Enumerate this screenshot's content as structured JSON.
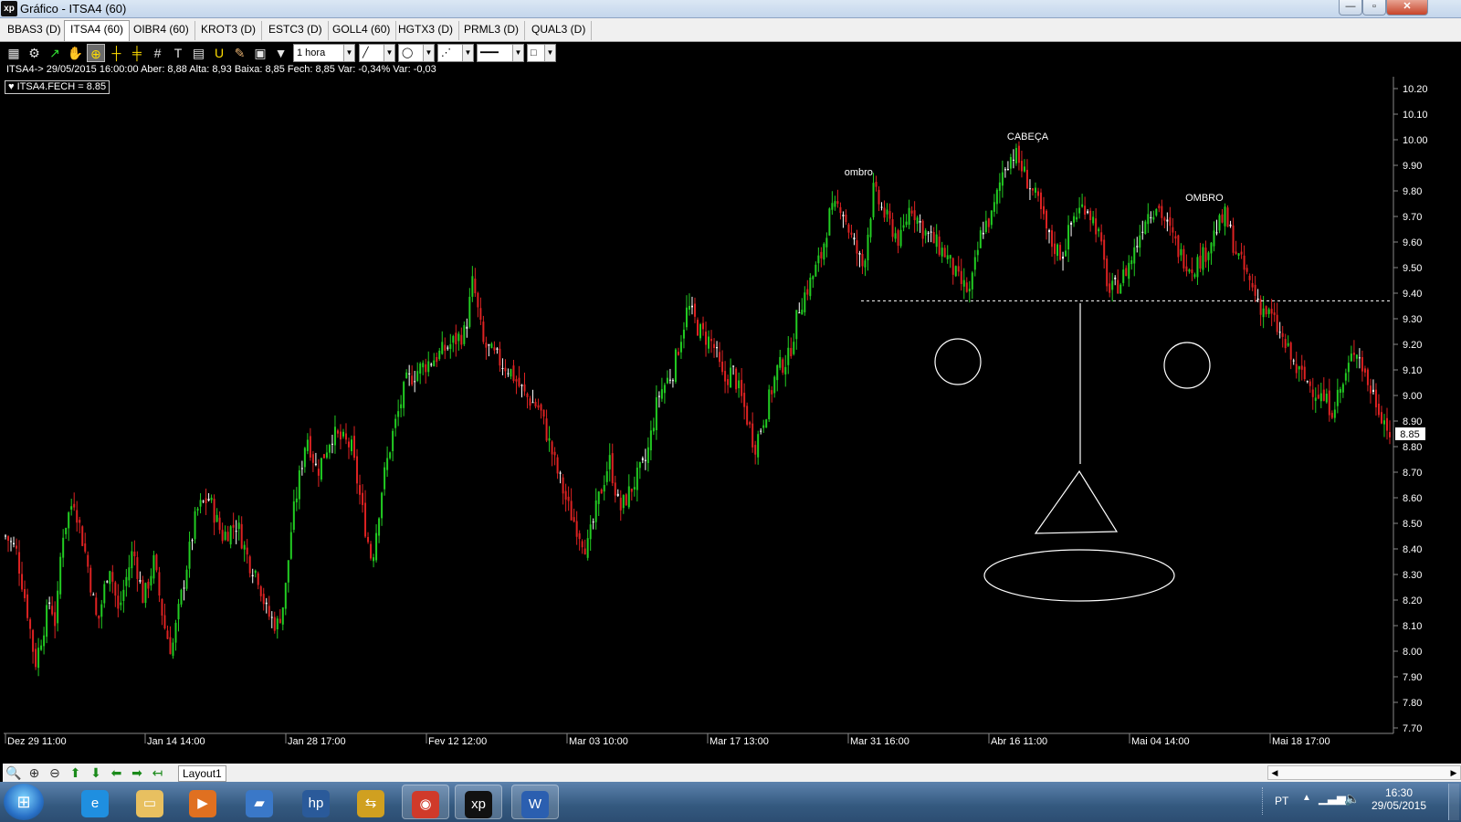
{
  "window": {
    "app_icon": "xp",
    "title": "Gráfico - ITSA4 (60)",
    "minimize": "—",
    "restore": "▫",
    "close": "✕"
  },
  "tabs": [
    {
      "label": "BBAS3 (D)"
    },
    {
      "label": "ITSA4 (60)",
      "active": true
    },
    {
      "label": "OIBR4 (60)"
    },
    {
      "label": "KROT3 (D)"
    },
    {
      "label": "ESTC3 (D)"
    },
    {
      "label": "GOLL4 (60)"
    },
    {
      "label": "HGTX3 (D)"
    },
    {
      "label": "PRML3 (D)"
    },
    {
      "label": "QUAL3 (D)"
    }
  ],
  "toolbar": {
    "icons": [
      "chart-icon",
      "gear-icon",
      "trend-icon",
      "hand-icon",
      "zoom-crosshair-icon",
      "crosshair-icon",
      "multi-crosshair-icon",
      "grid-icon",
      "text-icon",
      "calculator-icon",
      "magnet-icon",
      "brush-icon",
      "clipboard-icon",
      "filter-icon"
    ],
    "period": "1 hora",
    "line_tool": "line-icon",
    "shape_tool": "circle-icon",
    "fan_tool": "fan-icon",
    "line_style": "solid",
    "color_box": "#ffffff"
  },
  "info": {
    "line": "ITSA4-> 29/05/2015 16:00:00 Aber: 8,88 Alta: 8,93 Baixa: 8,85 Fech: 8,85 Var: -0,34% Var: -0,03",
    "legend": "ITSA4.FECH = 8.85"
  },
  "chart": {
    "symbol": "ITSA4",
    "interval": "60",
    "y_ticks": [
      "10.20",
      "10.10",
      "10.00",
      "9.90",
      "9.80",
      "9.70",
      "9.60",
      "9.50",
      "9.40",
      "9.30",
      "9.20",
      "9.10",
      "9.00",
      "8.90",
      "8.80",
      "8.70",
      "8.60",
      "8.50",
      "8.40",
      "8.30",
      "8.20",
      "8.10",
      "8.00",
      "7.90",
      "7.80",
      "7.70"
    ],
    "y_range": [
      7.7,
      10.2
    ],
    "x_ticks": [
      "Dez 29 11:00",
      "Jan 14 14:00",
      "Jan 28 17:00",
      "Fev 12 12:00",
      "Mar 03 10:00",
      "Mar 17 13:00",
      "Mar 31 16:00",
      "Abr 16 11:00",
      "Mai 04 14:00",
      "Mai 18 17:00"
    ],
    "last_price": "8.85",
    "up_color": "#22cc22",
    "down_color": "#dd2222",
    "neutral_color": "#ffffff",
    "price_path": [
      [
        0,
        8.45
      ],
      [
        0.7,
        8.4
      ],
      [
        1.5,
        8.15
      ],
      [
        2.0,
        7.95
      ],
      [
        3.0,
        8.2
      ],
      [
        3.4,
        8.1
      ],
      [
        3.8,
        8.45
      ],
      [
        4.6,
        8.6
      ],
      [
        5.5,
        8.35
      ],
      [
        6.2,
        8.1
      ],
      [
        7.0,
        8.35
      ],
      [
        7.6,
        8.15
      ],
      [
        8.6,
        8.4
      ],
      [
        9.3,
        8.2
      ],
      [
        10.0,
        8.35
      ],
      [
        10.7,
        8.1
      ],
      [
        11.2,
        8.0
      ],
      [
        12.1,
        8.3
      ],
      [
        12.9,
        8.55
      ],
      [
        13.7,
        8.6
      ],
      [
        14.6,
        8.45
      ],
      [
        15.6,
        8.5
      ],
      [
        16.4,
        8.35
      ],
      [
        17.0,
        8.3
      ],
      [
        17.6,
        8.15
      ],
      [
        18.3,
        8.1
      ],
      [
        18.8,
        8.2
      ],
      [
        19.3,
        8.5
      ],
      [
        20.3,
        8.85
      ],
      [
        21.0,
        8.7
      ],
      [
        22.0,
        8.85
      ],
      [
        23.3,
        8.8
      ],
      [
        24.2,
        8.5
      ],
      [
        24.7,
        8.35
      ],
      [
        25.4,
        8.65
      ],
      [
        26.1,
        8.85
      ],
      [
        27.0,
        9.05
      ],
      [
        27.8,
        9.1
      ],
      [
        29.0,
        9.15
      ],
      [
        30.0,
        9.2
      ],
      [
        31.0,
        9.25
      ],
      [
        31.5,
        9.45
      ],
      [
        32.2,
        9.2
      ],
      [
        33.0,
        9.15
      ],
      [
        34.0,
        9.1
      ],
      [
        35.0,
        9.0
      ],
      [
        36.0,
        8.95
      ],
      [
        37.2,
        8.7
      ],
      [
        38.0,
        8.55
      ],
      [
        39.2,
        8.4
      ],
      [
        40.0,
        8.6
      ],
      [
        40.7,
        8.75
      ],
      [
        41.4,
        8.55
      ],
      [
        42.3,
        8.65
      ],
      [
        43.2,
        8.75
      ],
      [
        44.0,
        9.0
      ],
      [
        45.0,
        9.1
      ],
      [
        46.0,
        9.35
      ],
      [
        46.8,
        9.25
      ],
      [
        47.7,
        9.2
      ],
      [
        48.4,
        9.05
      ],
      [
        49.0,
        9.1
      ],
      [
        49.8,
        8.95
      ],
      [
        50.5,
        8.8
      ],
      [
        51.3,
        8.95
      ],
      [
        52.0,
        9.1
      ],
      [
        52.8,
        9.15
      ],
      [
        53.5,
        9.35
      ],
      [
        54.3,
        9.45
      ],
      [
        55.0,
        9.55
      ],
      [
        55.5,
        9.7
      ],
      [
        56.3,
        9.75
      ],
      [
        57.1,
        9.6
      ],
      [
        57.8,
        9.5
      ],
      [
        58.5,
        9.8
      ],
      [
        59.3,
        9.7
      ],
      [
        60.3,
        9.6
      ],
      [
        61.0,
        9.75
      ],
      [
        61.8,
        9.65
      ],
      [
        62.6,
        9.6
      ],
      [
        63.4,
        9.55
      ],
      [
        64.2,
        9.45
      ],
      [
        65.0,
        9.4
      ],
      [
        65.8,
        9.65
      ],
      [
        66.5,
        9.7
      ],
      [
        67.3,
        9.9
      ],
      [
        68.0,
        9.95
      ],
      [
        68.8,
        9.85
      ],
      [
        69.6,
        9.75
      ],
      [
        70.4,
        9.6
      ],
      [
        71.2,
        9.55
      ],
      [
        72.0,
        9.7
      ],
      [
        72.8,
        9.75
      ],
      [
        73.6,
        9.65
      ],
      [
        74.4,
        9.4
      ],
      [
        75.2,
        9.45
      ],
      [
        76.0,
        9.55
      ],
      [
        76.8,
        9.7
      ],
      [
        77.6,
        9.75
      ],
      [
        78.4,
        9.65
      ],
      [
        79.2,
        9.55
      ],
      [
        80.0,
        9.5
      ],
      [
        80.8,
        9.55
      ],
      [
        81.6,
        9.65
      ],
      [
        82.2,
        9.7
      ],
      [
        83.0,
        9.55
      ],
      [
        83.8,
        9.45
      ],
      [
        84.6,
        9.35
      ],
      [
        85.4,
        9.3
      ],
      [
        86.2,
        9.2
      ],
      [
        87.0,
        9.1
      ],
      [
        87.8,
        9.05
      ],
      [
        88.6,
        9.0
      ],
      [
        89.4,
        8.95
      ],
      [
        90.2,
        9.05
      ],
      [
        91.0,
        9.2
      ],
      [
        91.8,
        9.05
      ],
      [
        92.6,
        8.95
      ],
      [
        93.3,
        8.85
      ]
    ],
    "neckline": 9.37,
    "annotations": [
      {
        "text": "ombro",
        "x": 57.5,
        "y": 9.86
      },
      {
        "text": "CABEÇA",
        "x": 68.9,
        "y": 10.0
      },
      {
        "text": "OMBRO",
        "x": 80.8,
        "y": 9.76
      }
    ]
  },
  "nav": {
    "icons": [
      "zoom-icon",
      "zoom-in-icon",
      "zoom-out-icon",
      "arrow-up-icon",
      "arrow-down-icon",
      "arrow-left-icon",
      "arrow-right-icon",
      "arrow-end-icon"
    ],
    "layout_tab": "Layout1"
  },
  "taskbar": {
    "apps": [
      "ie-icon",
      "explorer-icon",
      "media-player-icon",
      "network-icon",
      "hp-icon",
      "transfer-icon",
      "chrome-icon",
      "xp-app-icon",
      "word-icon"
    ],
    "lang": "PT",
    "time": "16:30",
    "date": "29/05/2015"
  }
}
